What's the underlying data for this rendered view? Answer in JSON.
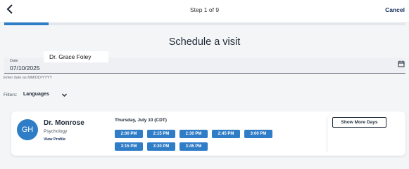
{
  "header": {
    "back_icon": "chevron-left-icon",
    "step_label": "Step 1 of 9",
    "cancel_label": "Cancel",
    "progress_fraction": 0.111
  },
  "page": {
    "heading": "Schedule a visit",
    "tooltip": "Dr. Grace Foley"
  },
  "date_field": {
    "label": "Date",
    "value": "07/10/2025",
    "hint": "Enter date as MM/DD/YYYY",
    "icon": "calendar-icon"
  },
  "filters": {
    "label": "Filters:",
    "languages_label": "Languages",
    "chevron_icon": "chevron-down-icon"
  },
  "provider": {
    "initials": "GH",
    "name": "Dr. Monrose",
    "specialty": "Psychology",
    "view_profile": "View Profile",
    "day_label": "Thursday, July 10 (CDT)",
    "slots": [
      "2:00 PM",
      "2:15 PM",
      "2:30 PM",
      "2:45 PM",
      "3:00 PM",
      "3:15 PM",
      "3:30 PM",
      "3:45 PM"
    ],
    "more_days_label": "Show More Days"
  },
  "colors": {
    "accent": "#2f7cc7",
    "brand_dark": "#0f2b5b",
    "background": "#f4f5f7"
  }
}
